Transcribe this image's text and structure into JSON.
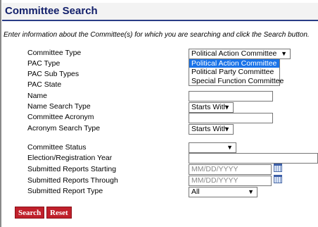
{
  "page": {
    "title": "Committee Search",
    "instructions": "Enter information about the Committee(s) for which you are searching and click the Search button."
  },
  "labels": {
    "committee_type": "Committee Type",
    "pac_type": "PAC Type",
    "pac_sub_types": "PAC Sub Types",
    "pac_state": "PAC State",
    "name": "Name",
    "name_search_type": "Name Search Type",
    "committee_acronym": "Committee Acronym",
    "acronym_search_type": "Acronym Search Type",
    "committee_status": "Committee Status",
    "election_year": "Election/Registration Year",
    "submitted_starting": "Submitted Reports Starting",
    "submitted_through": "Submitted Reports Through",
    "submitted_report_type": "Submitted Report Type"
  },
  "fields": {
    "committee_type": "Political Action Committee",
    "name": "",
    "name_search_type": "Starts With",
    "committee_acronym": "",
    "acronym_search_type": "Starts With",
    "committee_status": "",
    "election_year": "",
    "submitted_starting_placeholder": "MM/DD/YYYY",
    "submitted_through_placeholder": "MM/DD/YYYY",
    "submitted_report_type": "All"
  },
  "committee_type_options": [
    "Political Action Committee",
    "Political Party Committee",
    "Special Function Committee"
  ],
  "buttons": {
    "search": "Search",
    "reset": "Reset"
  },
  "icons": {
    "dropdown_arrow": "chevron-down-icon",
    "calendar": "calendar-icon"
  },
  "colors": {
    "title_text": "#13206b",
    "title_rule": "#2a3d86",
    "button_bg": "#c0202b",
    "selected_option_bg": "#1a73e8"
  }
}
